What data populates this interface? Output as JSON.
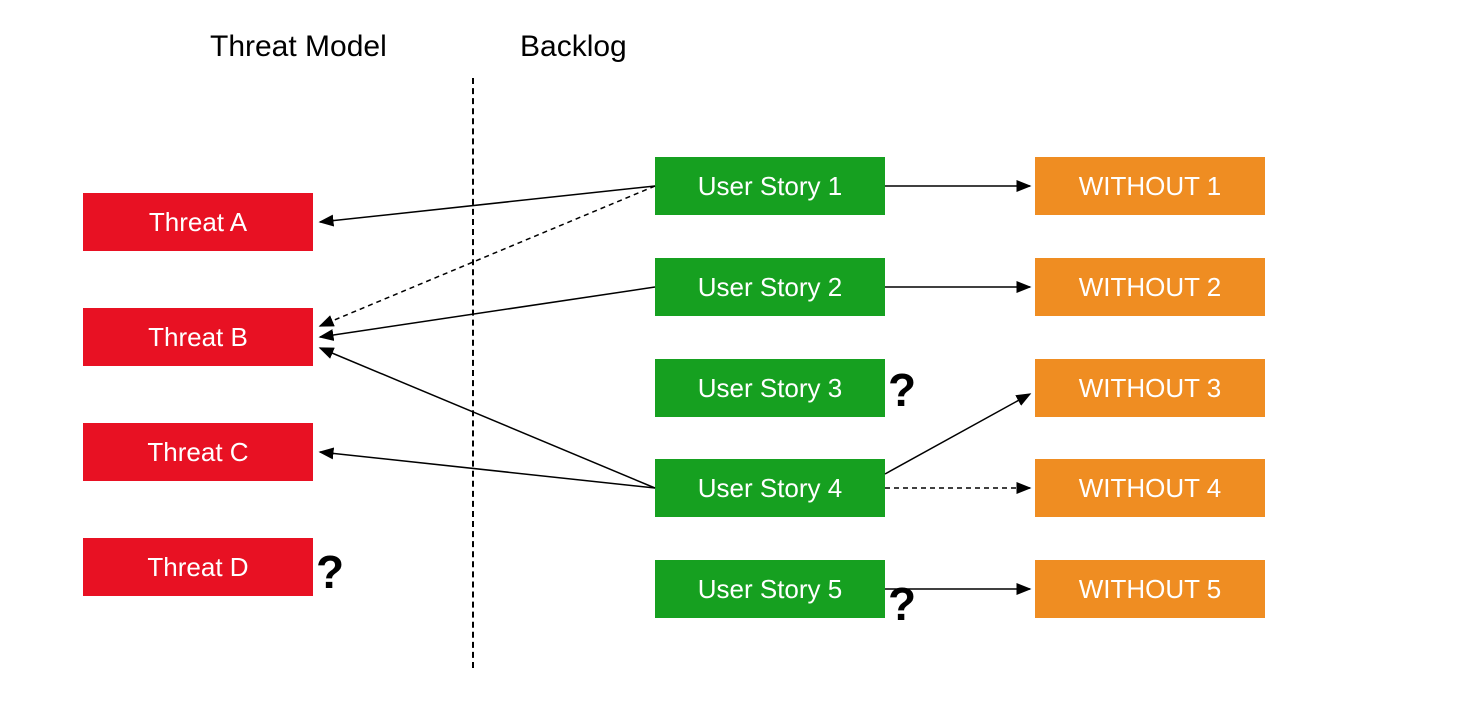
{
  "headings": {
    "threat_model": "Threat Model",
    "backlog": "Backlog"
  },
  "threats": [
    {
      "label": "Threat A"
    },
    {
      "label": "Threat B"
    },
    {
      "label": "Threat C"
    },
    {
      "label": "Threat D"
    }
  ],
  "user_stories": [
    {
      "label": "User Story 1"
    },
    {
      "label": "User Story 2"
    },
    {
      "label": "User Story 3"
    },
    {
      "label": "User Story 4"
    },
    {
      "label": "User Story 5"
    }
  ],
  "withouts": [
    {
      "label": "WITHOUT 1"
    },
    {
      "label": "WITHOUT 2"
    },
    {
      "label": "WITHOUT 3"
    },
    {
      "label": "WITHOUT 4"
    },
    {
      "label": "WITHOUT 5"
    }
  ],
  "question_marks": {
    "threat_d": "?",
    "user_story_3": "?",
    "user_story_5": "?"
  },
  "colors": {
    "threat": "#e81123",
    "user_story": "#16a020",
    "without": "#ef8d22"
  },
  "arrows": [
    {
      "from": "user_story_1",
      "to": "threat_a",
      "style": "solid"
    },
    {
      "from": "user_story_1",
      "to": "threat_b",
      "style": "dashed"
    },
    {
      "from": "user_story_2",
      "to": "threat_b",
      "style": "solid"
    },
    {
      "from": "user_story_4",
      "to": "threat_b",
      "style": "solid"
    },
    {
      "from": "user_story_4",
      "to": "threat_c",
      "style": "solid"
    },
    {
      "from": "user_story_1",
      "to": "without_1",
      "style": "solid"
    },
    {
      "from": "user_story_2",
      "to": "without_2",
      "style": "solid"
    },
    {
      "from": "user_story_4",
      "to": "without_3",
      "style": "solid"
    },
    {
      "from": "user_story_4",
      "to": "without_4",
      "style": "dashed"
    },
    {
      "from": "user_story_5",
      "to": "without_5",
      "style": "solid"
    }
  ]
}
